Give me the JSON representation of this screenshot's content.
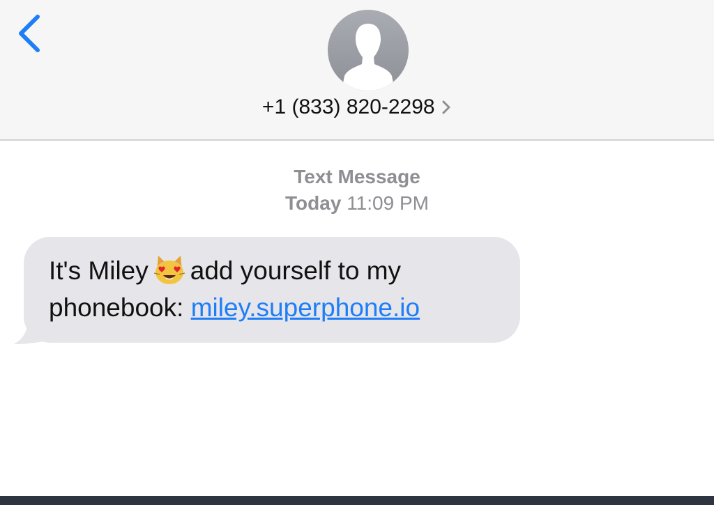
{
  "header": {
    "back_icon": "chevron-left-icon",
    "avatar_icon": "person-silhouette-icon",
    "contact_number": "+1 (833) 820-2298",
    "contact_chevron_icon": "chevron-right-icon"
  },
  "thread": {
    "message_type": "Text Message",
    "date_day": "Today",
    "date_time": "11:09 PM"
  },
  "message": {
    "text_before_emoji": "It's Miley",
    "emoji_icon": "smiling-cat-heart-eyes-icon",
    "text_after_emoji": "add yourself to my phonebook:",
    "link": "miley.superphone.io"
  },
  "colors": {
    "accent_blue": "#1e7ef7",
    "bubble_gray": "#e5e5ea",
    "header_bg": "#f6f6f6",
    "meta_gray": "#8e8e93"
  }
}
